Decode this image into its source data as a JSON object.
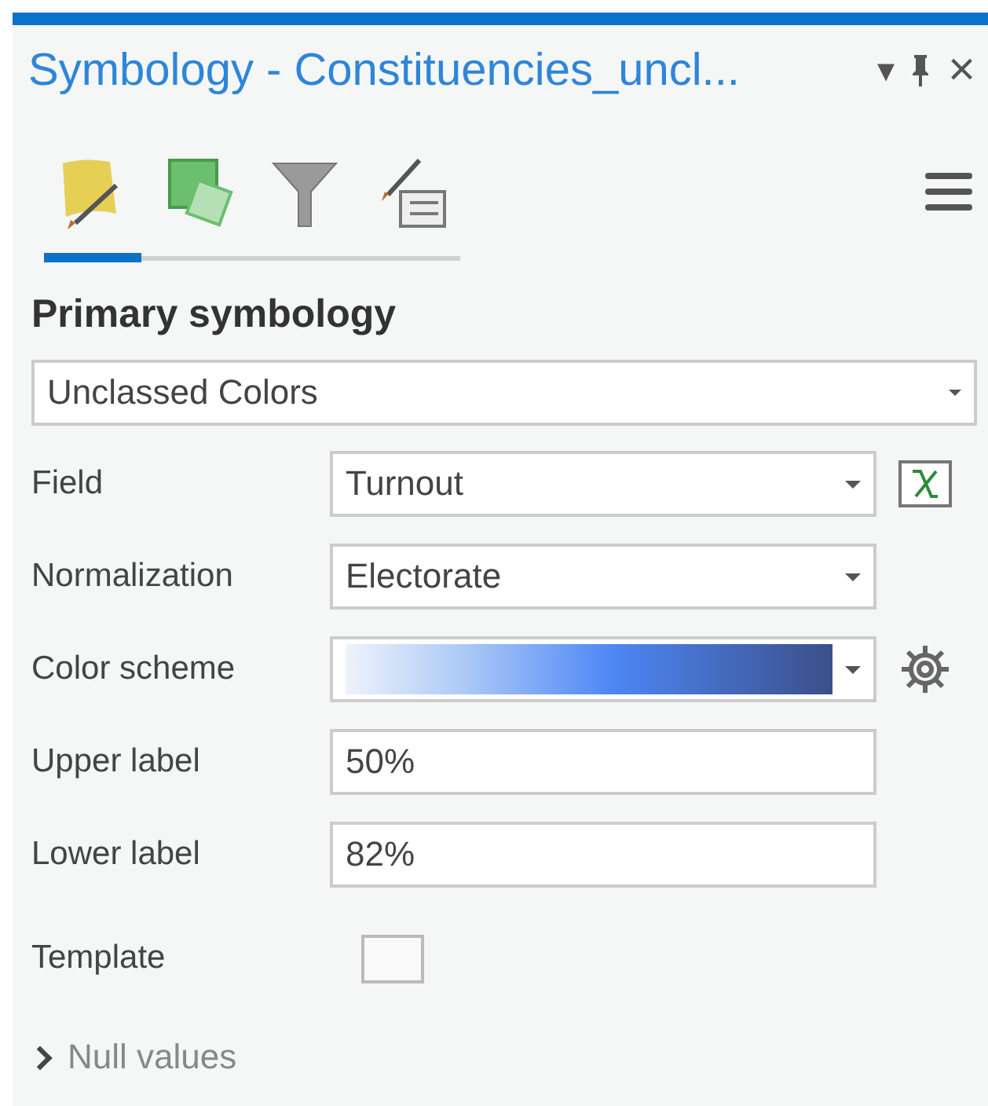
{
  "window": {
    "title": "Symbology - Constituencies_uncl...",
    "menu_glyph": "▾",
    "close_glyph": "×"
  },
  "tabs": [
    {
      "kind": "primary",
      "selected": true
    },
    {
      "kind": "vary",
      "selected": false
    },
    {
      "kind": "filter",
      "selected": false
    },
    {
      "kind": "label",
      "selected": false
    }
  ],
  "section": {
    "title": "Primary symbology",
    "renderer": "Unclassed Colors"
  },
  "rows": [
    {
      "kind": "field",
      "label": "Field",
      "value": "Turnout"
    },
    {
      "kind": "dropdown",
      "label": "Normalization",
      "value": "Electorate"
    },
    {
      "kind": "gradient",
      "label": "Color scheme"
    },
    {
      "kind": "text",
      "label": "Upper label",
      "value": "50%"
    },
    {
      "kind": "text",
      "label": "Lower label",
      "value": "82%"
    },
    {
      "kind": "checkbox",
      "label": "Template",
      "checked": false
    }
  ],
  "null_values": {
    "label": "Null values",
    "expanded": false
  }
}
